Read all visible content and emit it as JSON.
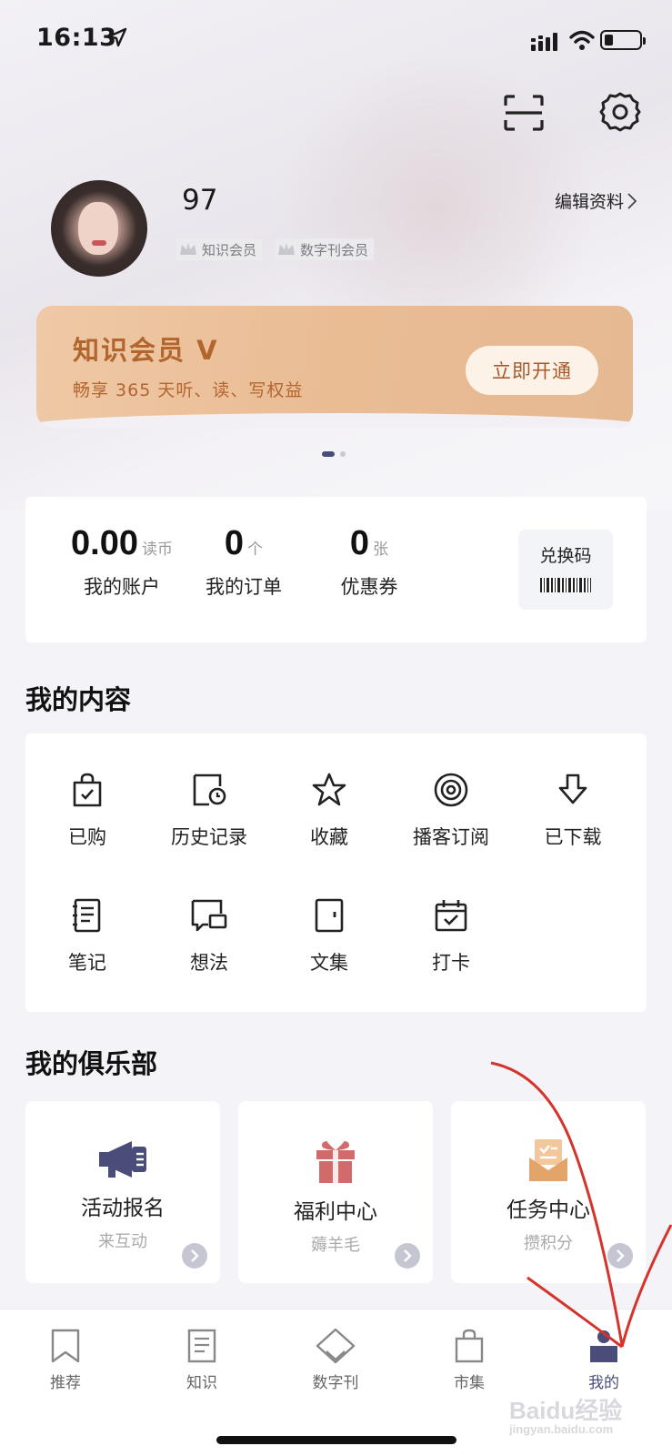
{
  "status": {
    "time": "16:13"
  },
  "profile": {
    "name": "97",
    "badges": [
      "知识会员",
      "数字刊会员"
    ],
    "edit_label": "编辑资料"
  },
  "vip_banner": {
    "title": "知识会员 V",
    "subtitle": "畅享 365 天听、读、写权益",
    "button": "立即开通"
  },
  "account": {
    "stats": [
      {
        "value": "0.00",
        "unit": "读币",
        "label": "我的账户"
      },
      {
        "value": "0",
        "unit": "个",
        "label": "我的订单"
      },
      {
        "value": "0",
        "unit": "张",
        "label": "优惠券"
      }
    ],
    "redeem_label": "兑换码"
  },
  "my_content": {
    "title": "我的内容",
    "items": [
      {
        "label": "已购",
        "icon": "shopping-bag-icon"
      },
      {
        "label": "历史记录",
        "icon": "history-icon"
      },
      {
        "label": "收藏",
        "icon": "star-icon"
      },
      {
        "label": "播客订阅",
        "icon": "podcast-icon"
      },
      {
        "label": "已下载",
        "icon": "download-icon"
      },
      {
        "label": "笔记",
        "icon": "notebook-icon"
      },
      {
        "label": "想法",
        "icon": "thought-icon"
      },
      {
        "label": "文集",
        "icon": "collection-icon"
      },
      {
        "label": "打卡",
        "icon": "checkin-icon"
      }
    ]
  },
  "my_club": {
    "title": "我的俱乐部",
    "cards": [
      {
        "title": "活动报名",
        "subtitle": "来互动",
        "icon": "megaphone-icon",
        "color": "#4a4d7a"
      },
      {
        "title": "福利中心",
        "subtitle": "薅羊毛",
        "icon": "gift-icon",
        "color": "#d16b6b"
      },
      {
        "title": "任务中心",
        "subtitle": "攒积分",
        "icon": "task-icon",
        "color": "#e3a46a"
      }
    ]
  },
  "tabbar": {
    "tabs": [
      {
        "label": "推荐",
        "icon": "bookmark-icon",
        "active": false
      },
      {
        "label": "知识",
        "icon": "document-icon",
        "active": false
      },
      {
        "label": "数字刊",
        "icon": "magazine-icon",
        "active": false
      },
      {
        "label": "市集",
        "icon": "bag-icon",
        "active": false
      },
      {
        "label": "我的",
        "icon": "profile-icon",
        "active": true
      }
    ]
  },
  "colors": {
    "accent": "#4a4d7a",
    "vip_text": "#b3652e",
    "vip_bg": "#e9bc94",
    "annotation": "#d4342b"
  },
  "watermark": {
    "text": "Baidu经验",
    "sub": "jingyan.baidu.com"
  }
}
